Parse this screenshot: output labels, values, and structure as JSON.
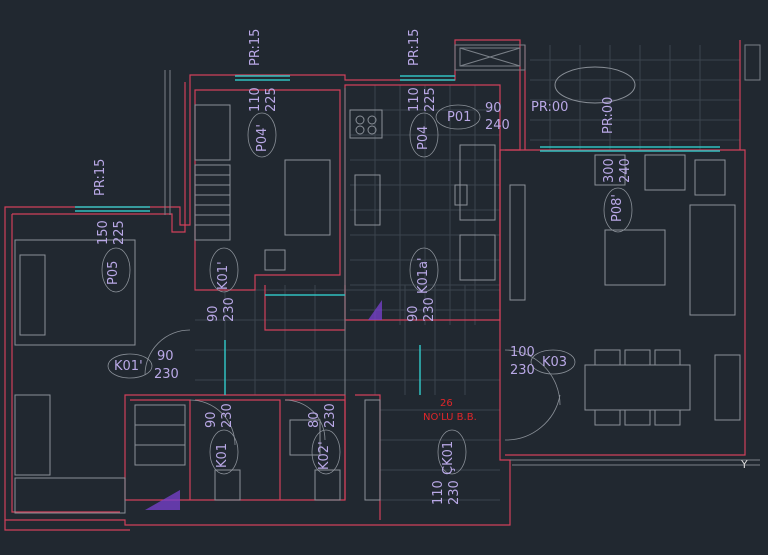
{
  "plan": {
    "labels": {
      "pr15_a": "PR:15",
      "pr15_b": "PR:15",
      "pr15_c": "PR:15",
      "pr00_a": "PR:00",
      "pr00_b": "PR:00",
      "p04p_w": "110",
      "p04p_h": "225",
      "p04p": "P04'",
      "p04_w": "110",
      "p04_h": "225",
      "p04": "P04",
      "p01": "P01",
      "p01_w": "90",
      "p01_h": "240",
      "p08_w": "300",
      "p08_h": "240",
      "p08": "P08'",
      "p05_w": "150",
      "p05_h": "225",
      "p05": "P05",
      "k01p_a": "K01'",
      "k01p_a_w": "90",
      "k01p_a_h": "230",
      "k01a": "K01a'",
      "k01a_w": "90",
      "k01a_h": "230",
      "k01p_b": "K01'",
      "k01p_b_w": "90",
      "k01p_b_h": "230",
      "k03_w": "100",
      "k03_h": "230",
      "k03": "K03",
      "k01_w": "90",
      "k01_h": "230",
      "k01": "K01",
      "k02_w": "80",
      "k02_h": "230",
      "k02": "K02'",
      "ck01": "ÇK01",
      "ck01_w": "110",
      "ck01_h": "230",
      "unit_no": "26",
      "unit_name": "NO'LU B.B.",
      "axis_y": "Y"
    },
    "colors": {
      "background": "#212830",
      "wall_outline": "#d0405a",
      "furniture": "#8a9098",
      "tile_grid": "#545c66",
      "label": "#b9a8e6",
      "opening": "#30c0c0",
      "hatch": "#7a40d0",
      "unit_label": "#e0262a"
    }
  }
}
